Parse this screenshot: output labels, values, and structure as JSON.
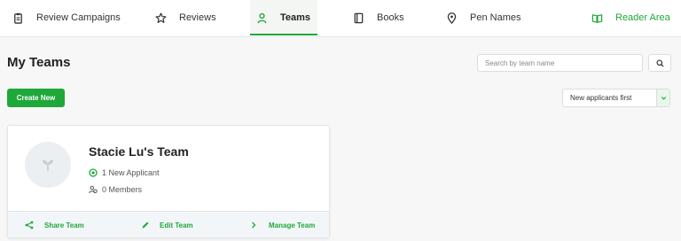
{
  "nav": {
    "review_campaigns": "Review Campaigns",
    "reviews": "Reviews",
    "teams": "Teams",
    "books": "Books",
    "pen_names": "Pen Names",
    "reader_area": "Reader Area",
    "active_tab": "Teams"
  },
  "page": {
    "title": "My Teams"
  },
  "search": {
    "placeholder": "Search by team name",
    "value": ""
  },
  "toolbar": {
    "create_label": "Create New",
    "sort_selected": "New applicants first"
  },
  "team_card": {
    "name": "Stacie Lu's Team",
    "applicants": "1 New Applicant",
    "members": "0 Members",
    "actions": {
      "share": "Share Team",
      "edit": "Edit Team",
      "manage": "Manage Team"
    }
  },
  "icons": {
    "review_campaigns": "clipboard-icon",
    "reviews": "star-icon",
    "teams": "person-icon",
    "books": "book-icon",
    "pen_names": "location-pin-icon",
    "reader_area": "open-book-icon",
    "search": "search-icon",
    "sort": "chevron-down-icon",
    "avatar": "sprout-icon",
    "applicants": "plus-circle-icon",
    "members": "people-icon",
    "share": "share-icon",
    "edit": "pencil-icon",
    "manage": "chevron-right-icon"
  },
  "colors": {
    "accent": "#1fa83a",
    "background": "#f7f7f7",
    "card_footer": "#f3f6f8"
  }
}
